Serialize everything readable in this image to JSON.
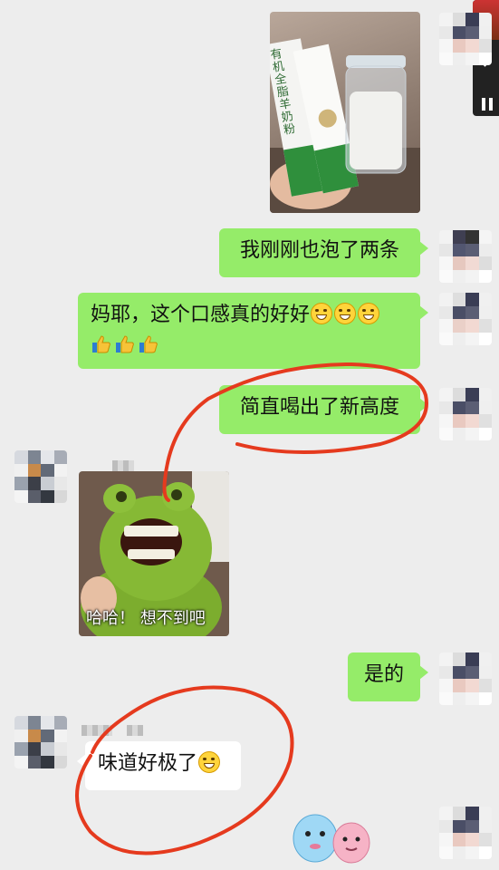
{
  "messages": {
    "m1_text": "我刚刚也泡了两条",
    "m2_text": "妈耶，这个口感真的好好",
    "m3_text": "简直喝出了新高度",
    "m4_caption": "哈哈！ 想不到吧",
    "m5_text": "是的",
    "m6_text": "味道好极了"
  },
  "product_pack": {
    "text": "有机全脂羊奶粉"
  },
  "colors": {
    "background": "#ededed",
    "my_bubble": "#95ec69",
    "other_bubble": "#ffffff",
    "annotation": "#e53a1e"
  },
  "icons": {
    "floating_back": "chevron-left-icon",
    "floating_pause": "pause-icon"
  }
}
